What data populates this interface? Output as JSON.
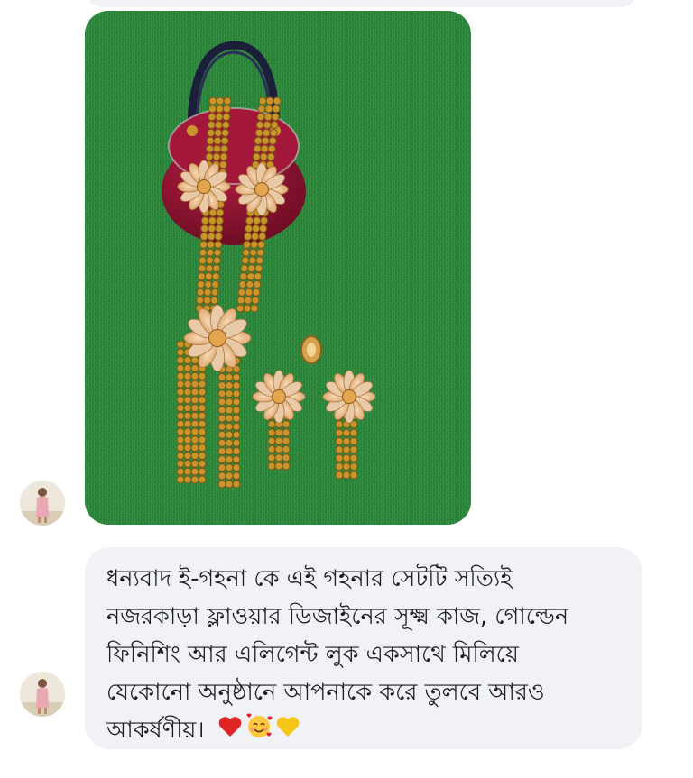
{
  "conversation": {
    "sender": {
      "avatar_icon": "user-avatar-icon"
    },
    "image_message": {
      "icon": "jewelry-photo",
      "colors": {
        "grass": "#2f8a3e",
        "box": "#8e1330",
        "gold": "#c9952b"
      }
    },
    "text_message": {
      "lines": [
        "ধন্যবাদ ই-গহনা কে এই গহনার সেটটি সত্যিই",
        "নজরকাড়া ফ্লাওয়ার ডিজাইনের সূক্ষ্ম কাজ, গোল্ডেন",
        "ফিনিশিং আর এলিগেন্ট লুক একসাথে মিলিয়ে",
        "যেকোনো অনুষ্ঠানে আপনাকে করে তুলবে আরও",
        "আকর্ষণীয়।"
      ],
      "emojis": [
        "heart-icon",
        "smiling-face-with-hearts-icon",
        "yellow-heart-icon"
      ],
      "bubble_color": "#f0f2f5"
    }
  }
}
